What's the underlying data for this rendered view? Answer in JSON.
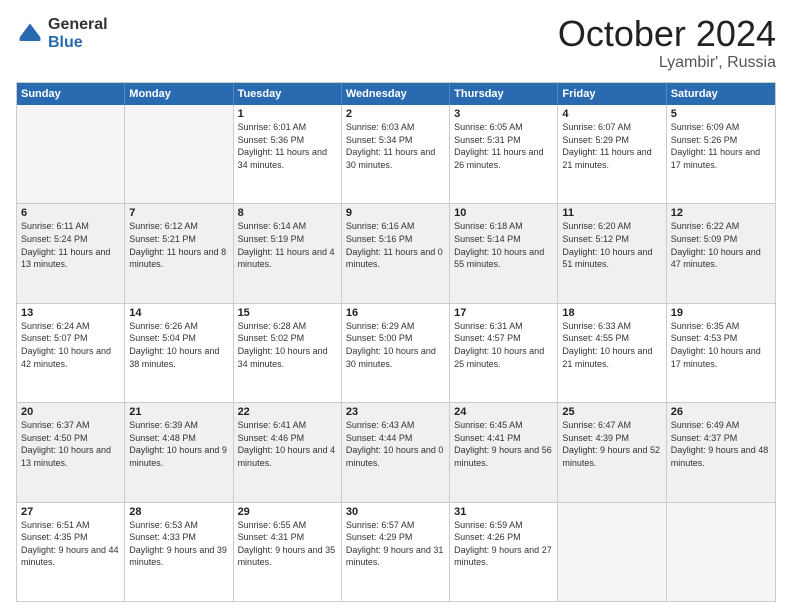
{
  "header": {
    "logo_general": "General",
    "logo_blue": "Blue",
    "title": "October 2024",
    "location": "Lyambir', Russia"
  },
  "days_of_week": [
    "Sunday",
    "Monday",
    "Tuesday",
    "Wednesday",
    "Thursday",
    "Friday",
    "Saturday"
  ],
  "weeks": [
    [
      {
        "day": "",
        "sunrise": "",
        "sunset": "",
        "daylight": "",
        "empty": true
      },
      {
        "day": "",
        "sunrise": "",
        "sunset": "",
        "daylight": "",
        "empty": true
      },
      {
        "day": "1",
        "sunrise": "Sunrise: 6:01 AM",
        "sunset": "Sunset: 5:36 PM",
        "daylight": "Daylight: 11 hours and 34 minutes."
      },
      {
        "day": "2",
        "sunrise": "Sunrise: 6:03 AM",
        "sunset": "Sunset: 5:34 PM",
        "daylight": "Daylight: 11 hours and 30 minutes."
      },
      {
        "day": "3",
        "sunrise": "Sunrise: 6:05 AM",
        "sunset": "Sunset: 5:31 PM",
        "daylight": "Daylight: 11 hours and 26 minutes."
      },
      {
        "day": "4",
        "sunrise": "Sunrise: 6:07 AM",
        "sunset": "Sunset: 5:29 PM",
        "daylight": "Daylight: 11 hours and 21 minutes."
      },
      {
        "day": "5",
        "sunrise": "Sunrise: 6:09 AM",
        "sunset": "Sunset: 5:26 PM",
        "daylight": "Daylight: 11 hours and 17 minutes."
      }
    ],
    [
      {
        "day": "6",
        "sunrise": "Sunrise: 6:11 AM",
        "sunset": "Sunset: 5:24 PM",
        "daylight": "Daylight: 11 hours and 13 minutes."
      },
      {
        "day": "7",
        "sunrise": "Sunrise: 6:12 AM",
        "sunset": "Sunset: 5:21 PM",
        "daylight": "Daylight: 11 hours and 8 minutes."
      },
      {
        "day": "8",
        "sunrise": "Sunrise: 6:14 AM",
        "sunset": "Sunset: 5:19 PM",
        "daylight": "Daylight: 11 hours and 4 minutes."
      },
      {
        "day": "9",
        "sunrise": "Sunrise: 6:16 AM",
        "sunset": "Sunset: 5:16 PM",
        "daylight": "Daylight: 11 hours and 0 minutes."
      },
      {
        "day": "10",
        "sunrise": "Sunrise: 6:18 AM",
        "sunset": "Sunset: 5:14 PM",
        "daylight": "Daylight: 10 hours and 55 minutes."
      },
      {
        "day": "11",
        "sunrise": "Sunrise: 6:20 AM",
        "sunset": "Sunset: 5:12 PM",
        "daylight": "Daylight: 10 hours and 51 minutes."
      },
      {
        "day": "12",
        "sunrise": "Sunrise: 6:22 AM",
        "sunset": "Sunset: 5:09 PM",
        "daylight": "Daylight: 10 hours and 47 minutes."
      }
    ],
    [
      {
        "day": "13",
        "sunrise": "Sunrise: 6:24 AM",
        "sunset": "Sunset: 5:07 PM",
        "daylight": "Daylight: 10 hours and 42 minutes."
      },
      {
        "day": "14",
        "sunrise": "Sunrise: 6:26 AM",
        "sunset": "Sunset: 5:04 PM",
        "daylight": "Daylight: 10 hours and 38 minutes."
      },
      {
        "day": "15",
        "sunrise": "Sunrise: 6:28 AM",
        "sunset": "Sunset: 5:02 PM",
        "daylight": "Daylight: 10 hours and 34 minutes."
      },
      {
        "day": "16",
        "sunrise": "Sunrise: 6:29 AM",
        "sunset": "Sunset: 5:00 PM",
        "daylight": "Daylight: 10 hours and 30 minutes."
      },
      {
        "day": "17",
        "sunrise": "Sunrise: 6:31 AM",
        "sunset": "Sunset: 4:57 PM",
        "daylight": "Daylight: 10 hours and 25 minutes."
      },
      {
        "day": "18",
        "sunrise": "Sunrise: 6:33 AM",
        "sunset": "Sunset: 4:55 PM",
        "daylight": "Daylight: 10 hours and 21 minutes."
      },
      {
        "day": "19",
        "sunrise": "Sunrise: 6:35 AM",
        "sunset": "Sunset: 4:53 PM",
        "daylight": "Daylight: 10 hours and 17 minutes."
      }
    ],
    [
      {
        "day": "20",
        "sunrise": "Sunrise: 6:37 AM",
        "sunset": "Sunset: 4:50 PM",
        "daylight": "Daylight: 10 hours and 13 minutes."
      },
      {
        "day": "21",
        "sunrise": "Sunrise: 6:39 AM",
        "sunset": "Sunset: 4:48 PM",
        "daylight": "Daylight: 10 hours and 9 minutes."
      },
      {
        "day": "22",
        "sunrise": "Sunrise: 6:41 AM",
        "sunset": "Sunset: 4:46 PM",
        "daylight": "Daylight: 10 hours and 4 minutes."
      },
      {
        "day": "23",
        "sunrise": "Sunrise: 6:43 AM",
        "sunset": "Sunset: 4:44 PM",
        "daylight": "Daylight: 10 hours and 0 minutes."
      },
      {
        "day": "24",
        "sunrise": "Sunrise: 6:45 AM",
        "sunset": "Sunset: 4:41 PM",
        "daylight": "Daylight: 9 hours and 56 minutes."
      },
      {
        "day": "25",
        "sunrise": "Sunrise: 6:47 AM",
        "sunset": "Sunset: 4:39 PM",
        "daylight": "Daylight: 9 hours and 52 minutes."
      },
      {
        "day": "26",
        "sunrise": "Sunrise: 6:49 AM",
        "sunset": "Sunset: 4:37 PM",
        "daylight": "Daylight: 9 hours and 48 minutes."
      }
    ],
    [
      {
        "day": "27",
        "sunrise": "Sunrise: 6:51 AM",
        "sunset": "Sunset: 4:35 PM",
        "daylight": "Daylight: 9 hours and 44 minutes."
      },
      {
        "day": "28",
        "sunrise": "Sunrise: 6:53 AM",
        "sunset": "Sunset: 4:33 PM",
        "daylight": "Daylight: 9 hours and 39 minutes."
      },
      {
        "day": "29",
        "sunrise": "Sunrise: 6:55 AM",
        "sunset": "Sunset: 4:31 PM",
        "daylight": "Daylight: 9 hours and 35 minutes."
      },
      {
        "day": "30",
        "sunrise": "Sunrise: 6:57 AM",
        "sunset": "Sunset: 4:29 PM",
        "daylight": "Daylight: 9 hours and 31 minutes."
      },
      {
        "day": "31",
        "sunrise": "Sunrise: 6:59 AM",
        "sunset": "Sunset: 4:26 PM",
        "daylight": "Daylight: 9 hours and 27 minutes."
      },
      {
        "day": "",
        "sunrise": "",
        "sunset": "",
        "daylight": "",
        "empty": true
      },
      {
        "day": "",
        "sunrise": "",
        "sunset": "",
        "daylight": "",
        "empty": true
      }
    ]
  ]
}
